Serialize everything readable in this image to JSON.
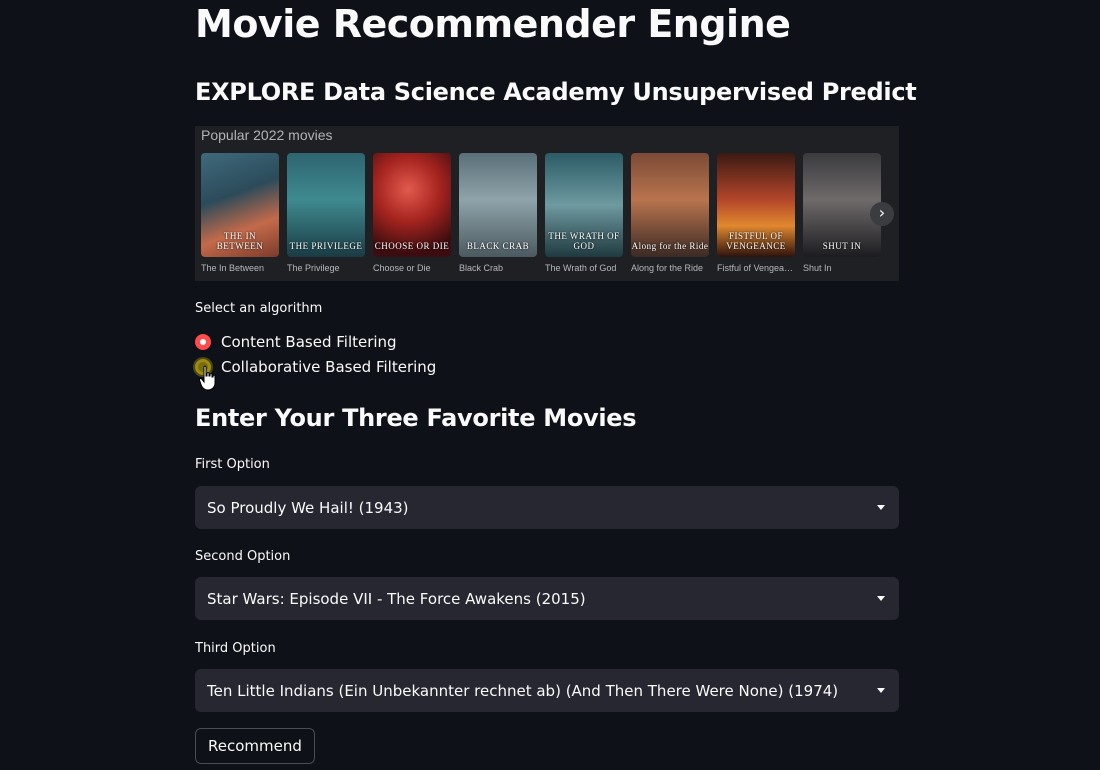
{
  "header": {
    "title": "Movie Recommender Engine",
    "subtitle": "EXPLORE Data Science Academy Unsupervised Predict"
  },
  "carousel": {
    "title": "Popular 2022 movies",
    "movies": [
      {
        "caption": "The In Between",
        "poster_text": "THE IN BETWEEN"
      },
      {
        "caption": "The Privilege",
        "poster_text": "THE PRIVILEGE"
      },
      {
        "caption": "Choose or Die",
        "poster_text": "CHOOSE OR DIE"
      },
      {
        "caption": "Black Crab",
        "poster_text": "BLACK CRAB"
      },
      {
        "caption": "The Wrath of God",
        "poster_text": "THE WRATH OF GOD"
      },
      {
        "caption": "Along for the Ride",
        "poster_text": "Along for the Ride"
      },
      {
        "caption": "Fistful of Vengea…",
        "poster_text": "FISTFUL OF VENGEANCE"
      },
      {
        "caption": "Shut In",
        "poster_text": "SHUT IN"
      }
    ]
  },
  "algorithm": {
    "label": "Select an algorithm",
    "options": [
      "Content Based Filtering",
      "Collaborative Based Filtering"
    ],
    "selected": "Content Based Filtering"
  },
  "favorites": {
    "heading": "Enter Your Three Favorite Movies",
    "first_label": "First Option",
    "first_value": "So Proudly We Hail! (1943)",
    "second_label": "Second Option",
    "second_value": "Star Wars: Episode VII - The Force Awakens (2015)",
    "third_label": "Third Option",
    "third_value": "Ten Little Indians (Ein Unbekannter rechnet ab) (And Then There Were None) (1974)"
  },
  "actions": {
    "recommend_label": "Recommend"
  },
  "colors": {
    "background": "#0e1117",
    "select_bg": "#262730",
    "accent": "#ff4b4b"
  }
}
